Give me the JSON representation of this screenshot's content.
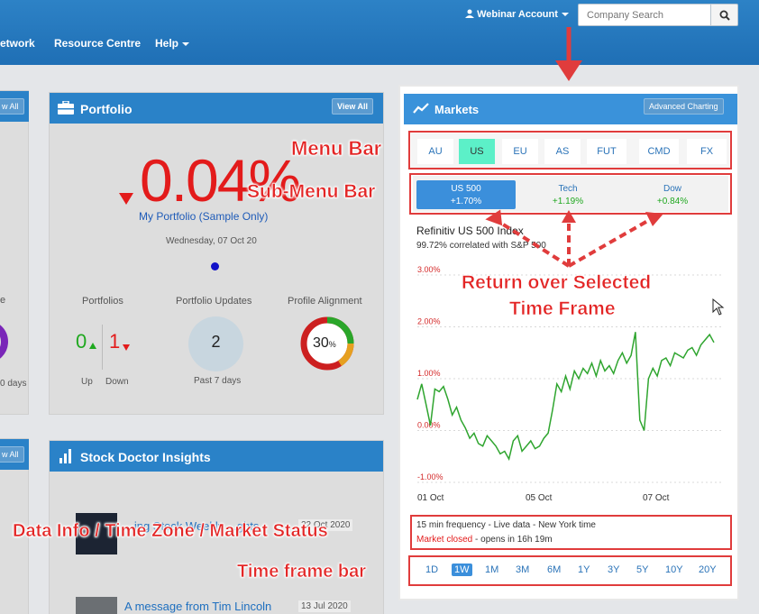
{
  "nav": {
    "partial_link": "etwork",
    "resource_centre": "Resource Centre",
    "help": "Help",
    "account": "Webinar Account",
    "search_placeholder": "Company Search"
  },
  "portfolio": {
    "title": "Portfolio",
    "view_all": "View All",
    "change": "0.04%",
    "link": "My Portfolio (Sample Only)",
    "date": "Wednesday, 07 Oct 20",
    "portfolios_label": "Portfolios",
    "up_value": "0",
    "down_value": "1",
    "up_label": "Up",
    "down_label": "Down",
    "updates_label": "Portfolio Updates",
    "updates_value": "2",
    "updates_sub": "Past 7 days",
    "alignment_label": "Profile Alignment",
    "alignment_value": "30",
    "alignment_unit": "%"
  },
  "left_partial": {
    "view_all": "w All",
    "e_text": "e",
    "days": "0 days",
    "view_all2": "w All"
  },
  "insights": {
    "title": "Stock Doctor Insights",
    "item1_title": "...ing Stock Weekly ...ghts",
    "item1_date": "22 Oct 2020",
    "item2_title": "A message from Tim Lincoln",
    "item2_date": "13 Jul 2020"
  },
  "markets": {
    "title": "Markets",
    "advanced": "Advanced Charting",
    "tabs": [
      "AU",
      "US",
      "EU",
      "AS",
      "FUT",
      "CMD",
      "FX"
    ],
    "active_tab": "US",
    "subtabs": [
      {
        "name": "US 500",
        "value": "+1.70%"
      },
      {
        "name": "Tech",
        "value": "+1.19%"
      },
      {
        "name": "Dow",
        "value": "+0.84%"
      }
    ],
    "index_name": "Refinitiv US 500 Index",
    "correlation": "99.72% correlated with S&P 500",
    "info_line": "15 min frequency - Live data - New York time",
    "status_closed": "Market closed",
    "status_rest": " - opens in 16h 19m",
    "timeframes": [
      "1D",
      "1W",
      "1M",
      "3M",
      "6M",
      "1Y",
      "3Y",
      "5Y",
      "10Y",
      "20Y"
    ],
    "active_timeframe": "1W"
  },
  "chart_data": {
    "type": "line",
    "x_ticks": [
      "01 Oct",
      "05 Oct",
      "07 Oct"
    ],
    "y_ticks": [
      "3.00%",
      "2.00%",
      "1.00%",
      "0.00%",
      "-1.00%"
    ],
    "ylim": [
      -1.0,
      3.0
    ],
    "series": [
      {
        "values": [
          0.6,
          0.9,
          0.5,
          0.1,
          0.8,
          0.75,
          0.85,
          0.6,
          0.3,
          0.45,
          0.2,
          0.05,
          -0.15,
          -0.05,
          -0.25,
          -0.3,
          -0.1,
          -0.2,
          -0.3,
          -0.45,
          -0.4,
          -0.55,
          -0.2,
          -0.1,
          -0.4,
          -0.3,
          -0.2,
          -0.35,
          -0.3,
          -0.15,
          -0.05,
          0.4,
          0.9,
          0.75,
          1.05,
          0.8,
          1.15,
          1.0,
          1.2,
          1.1,
          1.3,
          1.05,
          1.35,
          1.15,
          1.25,
          1.1,
          1.35,
          1.5,
          1.3,
          1.45,
          1.9,
          0.2,
          0.0,
          1.0,
          1.2,
          1.05,
          1.35,
          1.4,
          1.25,
          1.5,
          1.45,
          1.4,
          1.55,
          1.6,
          1.45,
          1.65,
          1.75,
          1.85,
          1.7
        ]
      }
    ]
  },
  "annotations": {
    "menu_bar": "Menu Bar",
    "sub_menu_bar": "Sub-Menu Bar",
    "return_line1": "Return over Selected",
    "return_line2": "Time Frame",
    "data_info": "Data Info / Time Zone / Market Status",
    "time_frame_bar": "Time frame bar"
  },
  "colors": {
    "nav_blue": "#2a82c8",
    "negative_red": "#e31b1b",
    "positive_green": "#1fa81f",
    "annotation_red": "#e32525",
    "active_tab": "#5cf0c8",
    "chart_line": "#2fa52f"
  }
}
